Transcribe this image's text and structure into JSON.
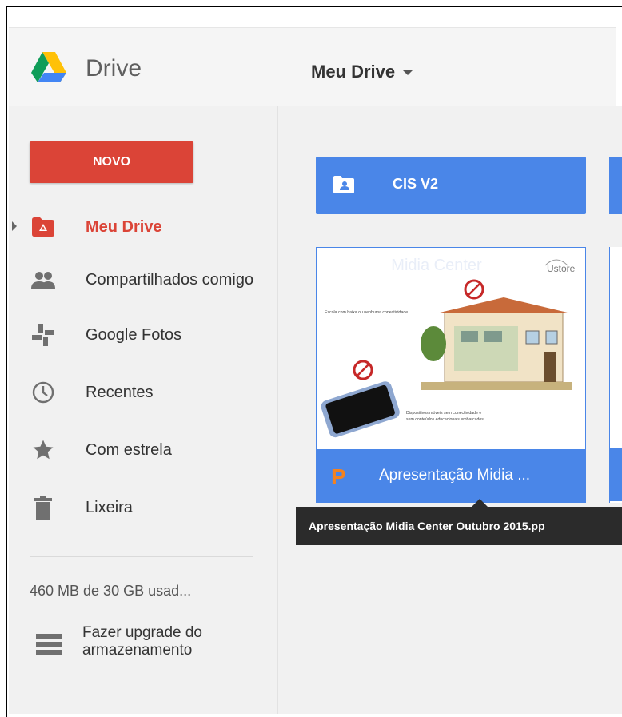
{
  "app": {
    "title": "Drive"
  },
  "header": {
    "location": "Meu Drive"
  },
  "sidebar": {
    "new_button": "NOVO",
    "items": [
      {
        "label": "Meu Drive",
        "icon": "my-drive-icon",
        "active": true
      },
      {
        "label": "Compartilhados comigo",
        "icon": "people-icon",
        "active": false
      },
      {
        "label": "Google Fotos",
        "icon": "photos-icon",
        "active": false
      },
      {
        "label": "Recentes",
        "icon": "clock-icon",
        "active": false
      },
      {
        "label": "Com estrela",
        "icon": "star-icon",
        "active": false
      },
      {
        "label": "Lixeira",
        "icon": "trash-icon",
        "active": false
      }
    ],
    "storage": "460 MB de 30 GB usad...",
    "upgrade": [
      "Fazer upgrade do",
      "armazenamento"
    ]
  },
  "folders": [
    {
      "name": "CIS V2",
      "icon": "shared-folder-icon"
    }
  ],
  "files": [
    {
      "name": "Apresentação Midia ...",
      "icon": "powerpoint-icon",
      "thumbnail": {
        "title": "Midia Center",
        "brand": "Ustore",
        "caption_top": "Escola com baixa ou nenhuma conectividade.",
        "caption_bottom": "Dispositivos móveis sem conectividade e sem conteúdos educacionais embarcados."
      }
    }
  ],
  "tooltip": "Apresentação Midia Center Outubro 2015.pp",
  "colors": {
    "accent_red": "#db4437",
    "accent_blue": "#4a86e8"
  }
}
